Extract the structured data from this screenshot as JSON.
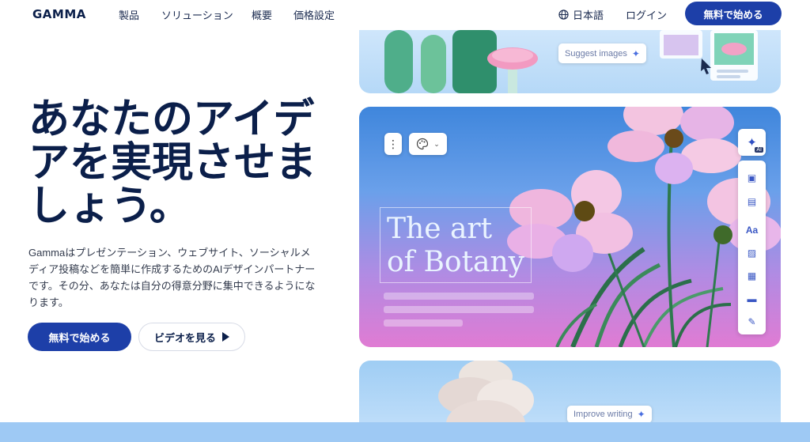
{
  "nav": {
    "logo": "GAMMA",
    "links": [
      "製品",
      "ソリューション",
      "概要",
      "価格設定"
    ],
    "language": "日本語",
    "login": "ログイン",
    "cta": "無料で始める"
  },
  "hero": {
    "headline_lines": [
      "あなたのアイデ",
      "アを実現させま",
      "しょう。"
    ],
    "description_lines": [
      "Gammaはプレゼンテーション、ウェブサイト、ソーシャルメ",
      "ディア投稿などを簡単に作成するためのAIデザインパートナー",
      "です。その分、あなたは自分の得意分野に集中できるようにな",
      "ります。"
    ],
    "primary_button": "無料で始める",
    "secondary_button": "ビデオを見る"
  },
  "preview": {
    "suggest_images": "Suggest images",
    "art_title_lines": [
      "The art",
      "of Botany"
    ],
    "improve_writing": "Improve writing",
    "ai_badge": "AI",
    "toolbar_text_icon": "Aa"
  },
  "icons": {
    "globe": "globe-icon",
    "play": "play-icon",
    "sparkle": "sparkle-icon",
    "palette": "palette-icon",
    "more": "more-vertical-icon"
  },
  "colors": {
    "brand": "#1d3fa8",
    "heading": "#0b1f4a"
  }
}
